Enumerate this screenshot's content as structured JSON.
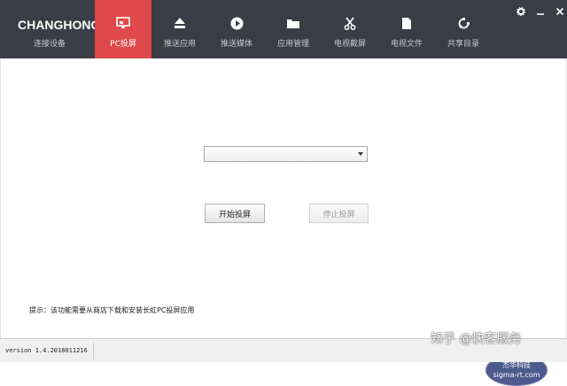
{
  "brand": {
    "logo": "CHANGHONG",
    "subtitle": "连接设备"
  },
  "tabs": [
    {
      "icon": "monitor-icon",
      "label": "PC投屏",
      "active": true
    },
    {
      "icon": "eject-icon",
      "label": "推送应用",
      "active": false
    },
    {
      "icon": "play-icon",
      "label": "推送媒体",
      "active": false
    },
    {
      "icon": "folder-icon",
      "label": "应用管理",
      "active": false
    },
    {
      "icon": "scissors-icon",
      "label": "电视截屏",
      "active": false
    },
    {
      "icon": "file-icon",
      "label": "电视文件",
      "active": false
    },
    {
      "icon": "share-icon",
      "label": "共享目录",
      "active": false
    }
  ],
  "window_controls": [
    "gear-icon",
    "minimize-icon",
    "close-icon"
  ],
  "main": {
    "device_select_value": "",
    "start_button": "开始投屏",
    "stop_button": "停止投屏",
    "tip": "提示：该功能需要从商店下载和安装长虹PC投屏应用"
  },
  "badge": {
    "line1": "杰华科技",
    "line2": "sigma-rt.com"
  },
  "watermark": "知乎 @快客服务",
  "status": {
    "version": "version 1.4.2018011216"
  },
  "colors": {
    "topbar": "#3a3d45",
    "active_tab": "#e0494b",
    "badge": "#4d5a8e"
  }
}
